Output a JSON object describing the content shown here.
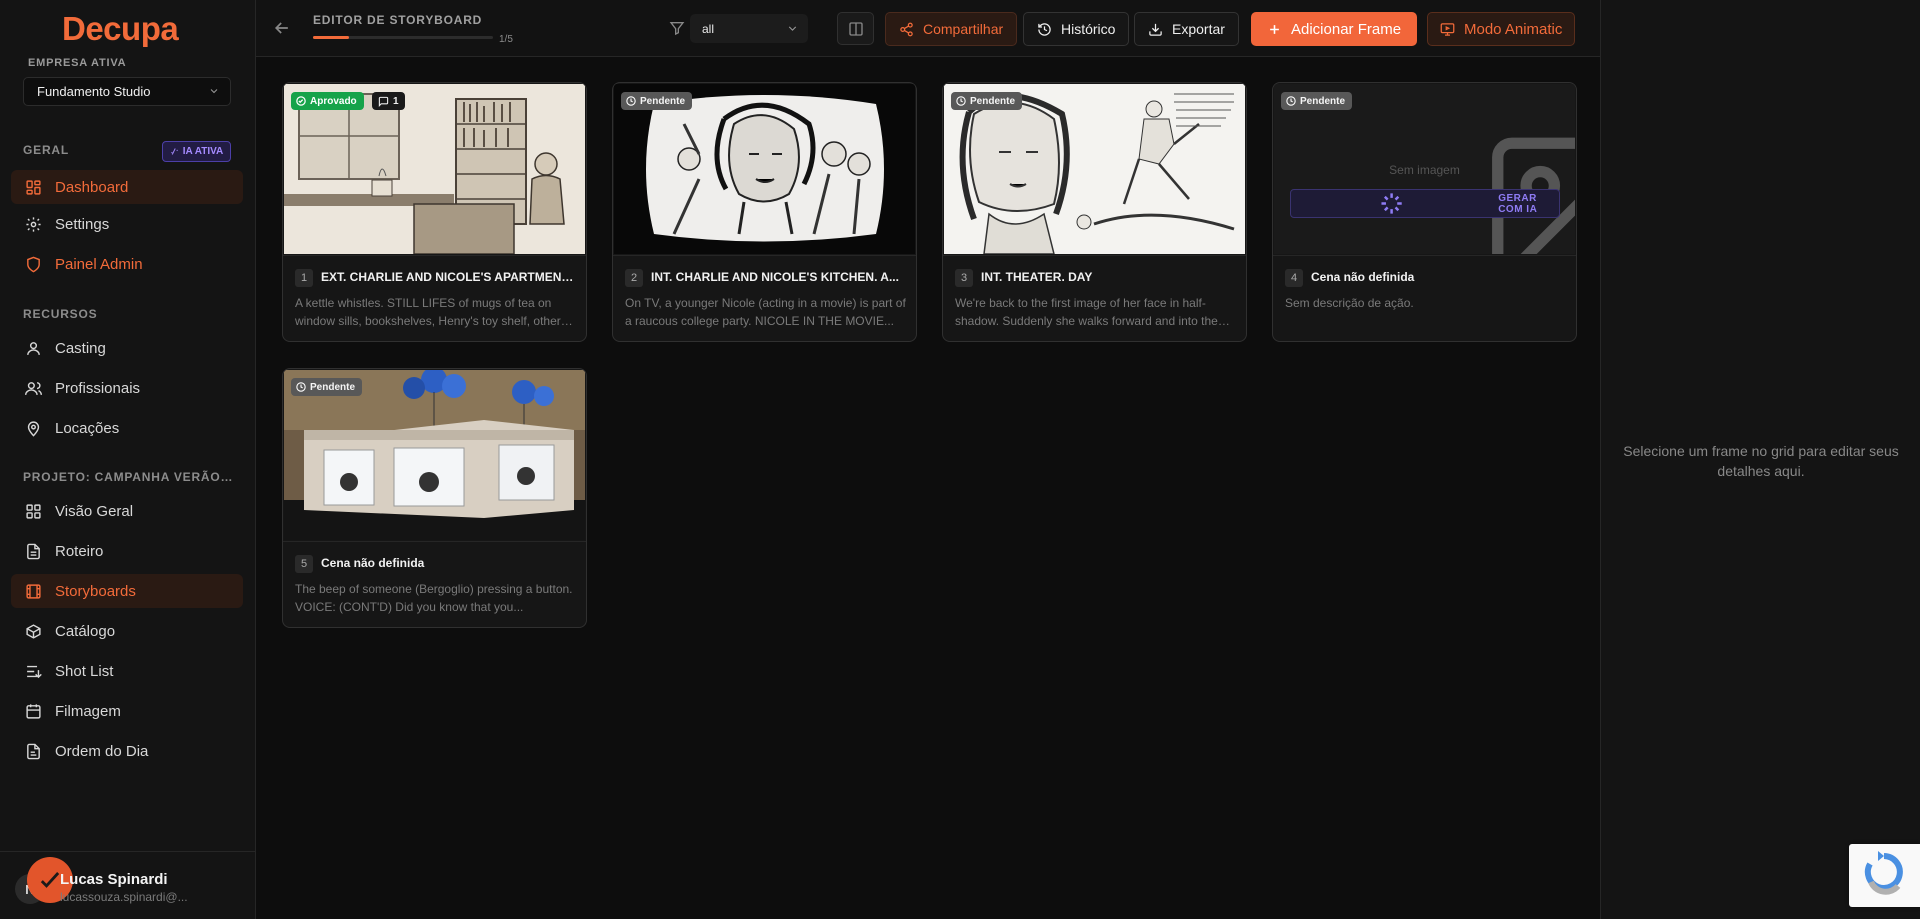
{
  "sidebar": {
    "logo": "Decupa",
    "company_label": "EMPRESA ATIVA",
    "company_value": "Fundamento Studio",
    "section_geral": "GERAL",
    "ia_badge": "IA ATIVA",
    "geral_items": [
      {
        "label": "Dashboard",
        "icon": "dashboard-icon",
        "active": true
      },
      {
        "label": "Settings",
        "icon": "gear-icon"
      },
      {
        "label": "Painel Admin",
        "icon": "shield-icon"
      }
    ],
    "section_recursos": "RECURSOS",
    "recursos_items": [
      {
        "label": "Casting",
        "icon": "user-icon"
      },
      {
        "label": "Profissionais",
        "icon": "users-icon"
      },
      {
        "label": "Locações",
        "icon": "map-pin-icon"
      }
    ],
    "section_projeto": "PROJETO: CAMPANHA VERÃO ...",
    "projeto_items": [
      {
        "label": "Visão Geral",
        "icon": "layout-icon"
      },
      {
        "label": "Roteiro",
        "icon": "document-icon"
      },
      {
        "label": "Storyboards",
        "icon": "film-icon",
        "active": true
      },
      {
        "label": "Catálogo",
        "icon": "package-icon"
      },
      {
        "label": "Shot List",
        "icon": "list-icon"
      },
      {
        "label": "Filmagem",
        "icon": "calendar-icon"
      },
      {
        "label": "Ordem do Dia",
        "icon": "clipboard-icon"
      }
    ],
    "user": {
      "initial": "N",
      "name": "Lucas Spinardi",
      "email": "lucassouza.spinardi@..."
    }
  },
  "header": {
    "title": "EDITOR DE STORYBOARD",
    "progress_text": "1/5",
    "progress": 0.2,
    "filter_value": "all",
    "buttons": {
      "share": "Compartilhar",
      "history": "Histórico",
      "export": "Exportar",
      "add_frame": "Adicionar Frame",
      "animatic": "Modo Animatic"
    }
  },
  "frames": [
    {
      "number": "1",
      "status": "Aprovado",
      "comments": "1",
      "title": "EXT. CHARLIE AND NICOLE'S APARTMENT - MORNING",
      "description": "A kettle whistles. STILL LIFES of mugs of tea on window sills, bookshelves, Henry's toy shelf, other morning things."
    },
    {
      "number": "2",
      "status": "Pendente",
      "title": "INT. CHARLIE AND NICOLE'S KITCHEN. A...",
      "description": "On TV, a younger Nicole (acting in a movie) is part of a raucous college party. NICOLE IN THE MOVIE..."
    },
    {
      "number": "3",
      "status": "Pendente",
      "title": "INT. THEATER. DAY",
      "description": "We're back to the first image of her face in half-shadow. Suddenly she walks forward and into the light..."
    },
    {
      "number": "4",
      "status": "Pendente",
      "title": "Cena não definida",
      "description": "Sem descrição de ação.",
      "no_image_text": "Sem imagem",
      "generate_label": "GERAR COM IA"
    },
    {
      "number": "5",
      "status": "Pendente",
      "title": "Cena não definida",
      "description": "The beep of someone (Bergoglio) pressing a button. VOICE: (CONT'D) Did you know that you..."
    }
  ],
  "right_panel": {
    "hint": "Selecione um frame no grid para editar seus detalhes aqui."
  },
  "colors": {
    "accent": "#f26b3a",
    "approved": "#16a34a",
    "pending": "#585858",
    "ia": "#8f7cf5"
  }
}
